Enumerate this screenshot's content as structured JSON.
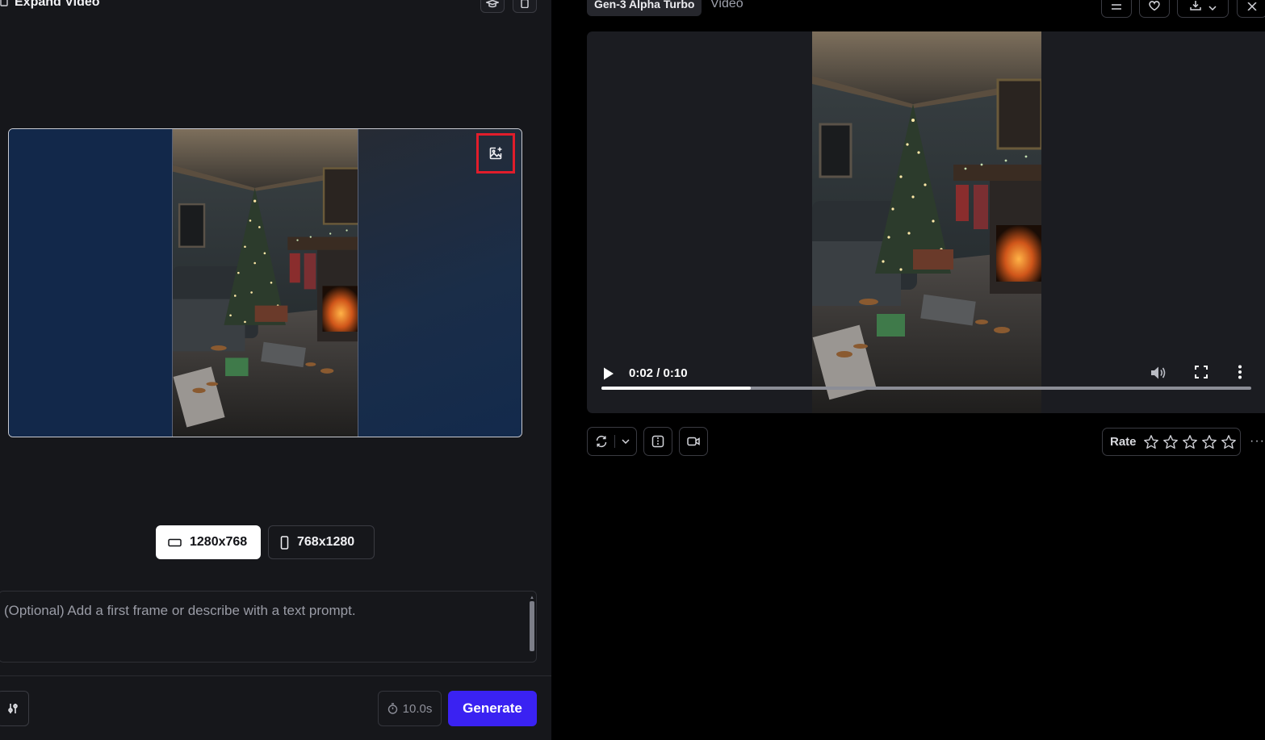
{
  "left_panel": {
    "title": "Expand Video",
    "aspect_ratios": [
      {
        "label": "1280x768",
        "selected": true
      },
      {
        "label": "768x1280",
        "selected": false
      }
    ],
    "prompt": {
      "placeholder": "(Optional) Add a first frame or describe with a text prompt.",
      "value": ""
    },
    "duration": "10.0s",
    "generate_label": "Generate"
  },
  "right_panel": {
    "model_tab": "Gen-3 Alpha Turbo",
    "type_tab": "Video",
    "video": {
      "time_display": "0:02 / 0:10",
      "progress": 0.23
    },
    "rating": {
      "label": "Rate",
      "stars": 5,
      "value": 0
    },
    "more_label": "···"
  },
  "colors": {
    "accent": "#3a22f2",
    "highlight_border": "#e11d2b",
    "panel_bg": "#16171b",
    "canvas_bg": "#12284a"
  }
}
